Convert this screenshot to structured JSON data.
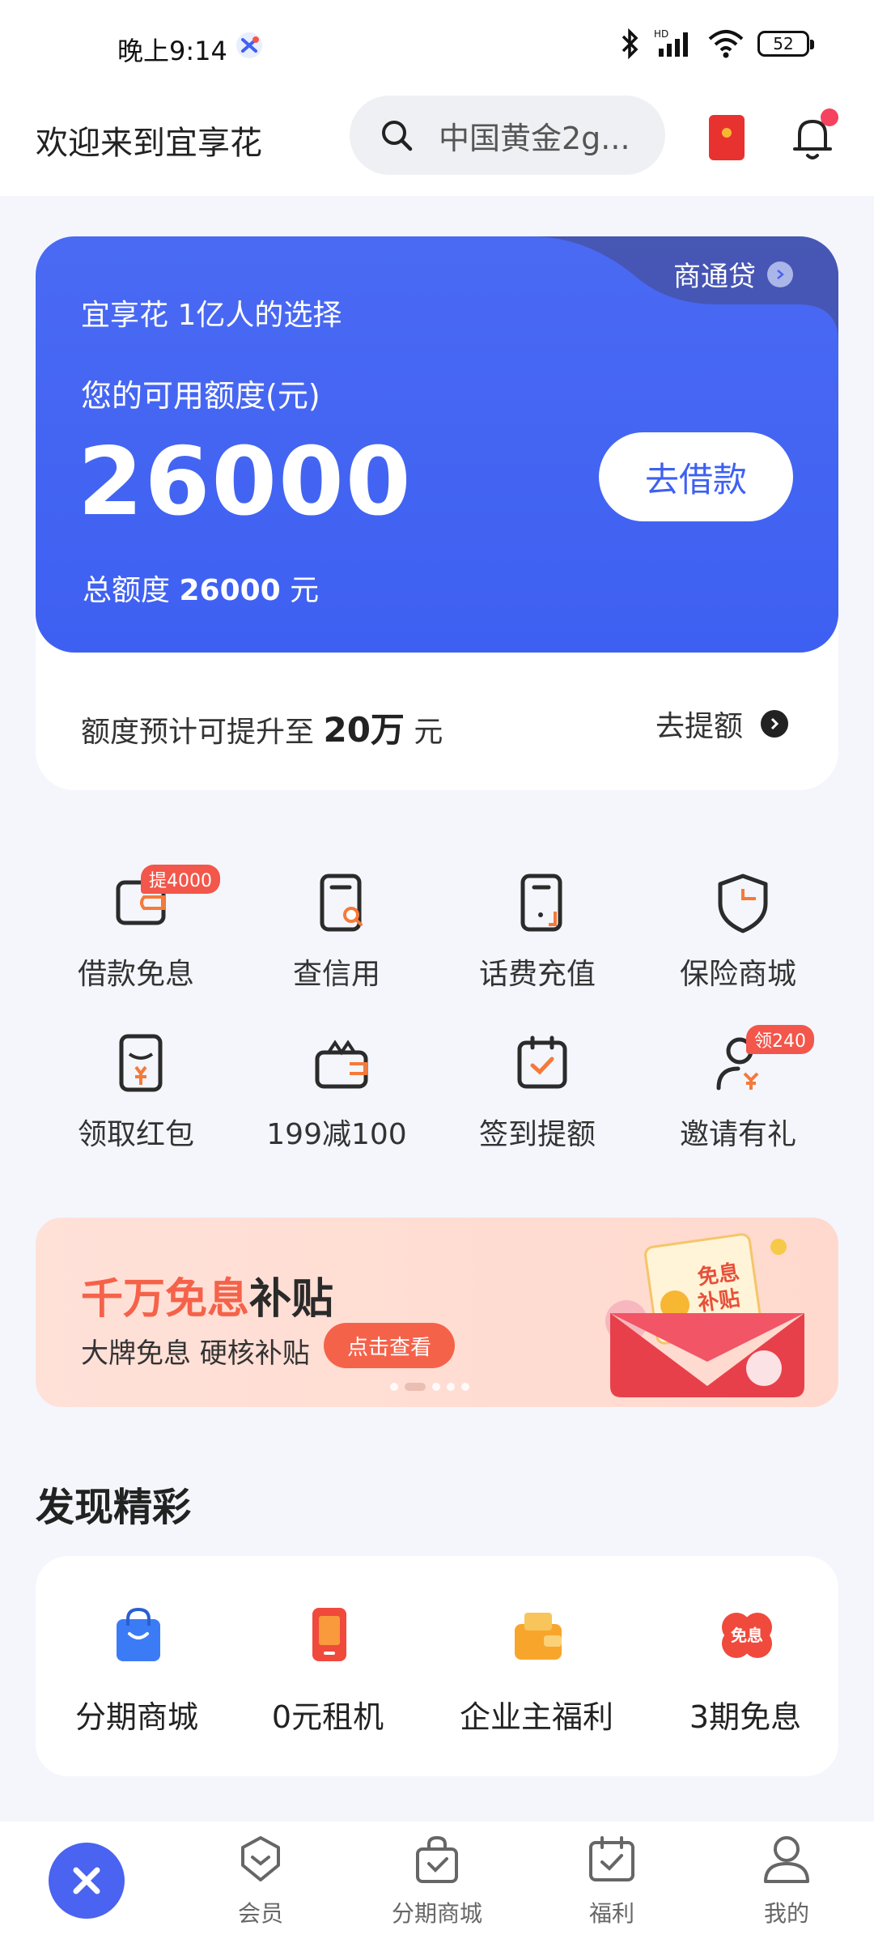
{
  "status_bar": {
    "time": "晚上9:14",
    "battery": "52"
  },
  "header": {
    "welcome": "欢迎来到宜享花",
    "search_placeholder": "中国黄金2g..."
  },
  "credit": {
    "shangtong_link": "商通贷",
    "tagline": "宜享花 1亿人的选择",
    "available_label": "您的可用额度(元)",
    "available_amount": "26000",
    "borrow_button": "去借款",
    "total_prefix": "总额度",
    "total_amount": "26000",
    "total_unit": "元",
    "raise_prefix": "额度预计可提升至",
    "raise_amount": "20万",
    "raise_unit": "元",
    "raise_link": "去提额"
  },
  "quick_grid": [
    {
      "label": "借款免息",
      "icon": "wallet-icon",
      "badge": "提4000"
    },
    {
      "label": "查信用",
      "icon": "credit-search-icon",
      "badge": ""
    },
    {
      "label": "话费充值",
      "icon": "phone-recharge-icon",
      "badge": ""
    },
    {
      "label": "保险商城",
      "icon": "shield-icon",
      "badge": ""
    },
    {
      "label": "领取红包",
      "icon": "red-envelope-icon",
      "badge": ""
    },
    {
      "label": "199减100",
      "icon": "gift-box-icon",
      "badge": ""
    },
    {
      "label": "签到提额",
      "icon": "calendar-check-icon",
      "badge": ""
    },
    {
      "label": "邀请有礼",
      "icon": "invite-user-icon",
      "badge": "领240"
    }
  ],
  "banner": {
    "title_highlight": "千万免息",
    "title_rest": "补贴",
    "subtitle": "大牌免息 硬核补贴",
    "button": "点击查看",
    "art_text_1": "免息",
    "art_text_2": "补贴"
  },
  "discover": {
    "title": "发现精彩",
    "items": [
      {
        "label": "分期商城",
        "icon": "shopping-bag-icon"
      },
      {
        "label": "0元租机",
        "icon": "phone-icon"
      },
      {
        "label": "企业主福利",
        "icon": "wallet-gift-icon"
      },
      {
        "label": "3期免息",
        "icon": "interest-free-icon",
        "icon_text": "免息"
      }
    ]
  },
  "bottom_nav": [
    {
      "label": "会员",
      "icon": "member-icon"
    },
    {
      "label": "分期商城",
      "icon": "mall-bag-icon"
    },
    {
      "label": "福利",
      "icon": "calendar-welfare-icon"
    },
    {
      "label": "我的",
      "icon": "profile-icon"
    }
  ],
  "colors": {
    "accent": "#3e60f2",
    "orange": "#f5624a",
    "badge": "#f3564a"
  }
}
